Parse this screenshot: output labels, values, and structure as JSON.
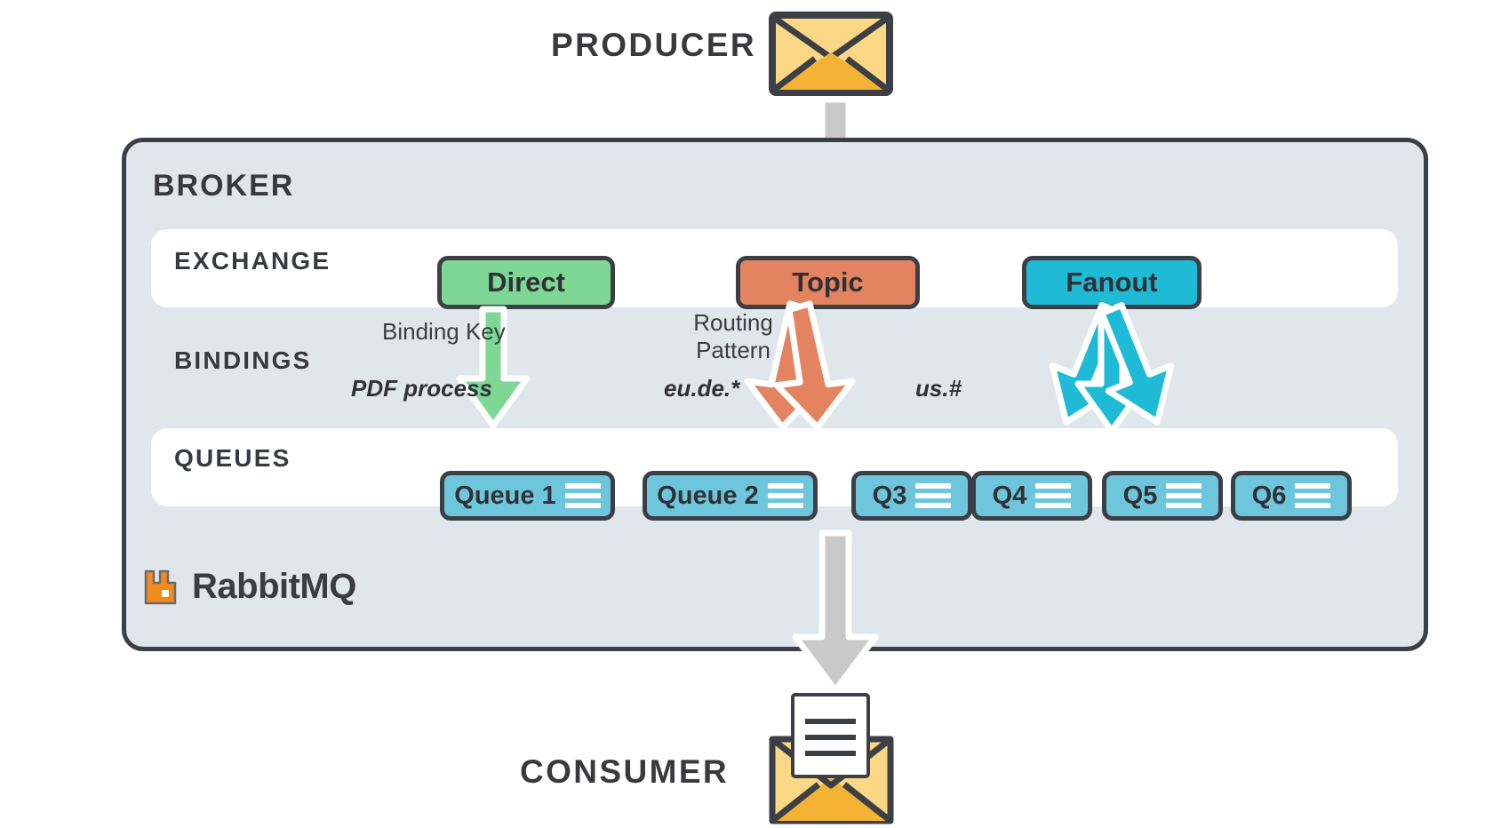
{
  "diagram": {
    "title": "RabbitMQ message broker architecture",
    "producer_label": "PRODUCER",
    "consumer_label": "CONSUMER",
    "broker_label": "BROKER",
    "brand_name": "RabbitMQ",
    "brand_icon": "rabbitmq-logo-icon",
    "producer_icon": "closed-envelope-icon",
    "consumer_icon": "open-envelope-with-letter-icon"
  },
  "sections": [
    {
      "key": "exchange",
      "label": "EXCHANGE"
    },
    {
      "key": "bindings",
      "label": "BINDINGS"
    },
    {
      "key": "queues",
      "label": "QUEUES"
    }
  ],
  "exchanges": [
    {
      "name": "Direct",
      "color": "#7ed795"
    },
    {
      "name": "Topic",
      "color": "#e38360"
    },
    {
      "name": "Fanout",
      "color": "#1fbad6"
    }
  ],
  "bindings": {
    "direct_note": "Binding Key",
    "direct_key": "PDF process",
    "topic_note_line1": "Routing",
    "topic_note_line2": "Pattern",
    "topic_key_left": "eu.de.*",
    "topic_key_right": "us.#"
  },
  "queues": [
    {
      "label": "Queue 1"
    },
    {
      "label": "Queue 2"
    },
    {
      "label": "Q3"
    },
    {
      "label": "Q4"
    },
    {
      "label": "Q5"
    },
    {
      "label": "Q6"
    }
  ],
  "colors": {
    "broker_fill": "#dfe6ec",
    "broker_stroke": "#3c3f45",
    "row_fill": "#ffffff",
    "queue_fill": "#6ec6dd",
    "direct_arrow": "#7ed795",
    "topic_arrow": "#e38360",
    "fanout_arrow": "#1fbad6",
    "flow_arrow": "#c9c9c9",
    "envelope_light": "#fbd786",
    "envelope_dark": "#f5b335",
    "brand_orange": "#f28b1e",
    "text_dark": "#36393e"
  }
}
